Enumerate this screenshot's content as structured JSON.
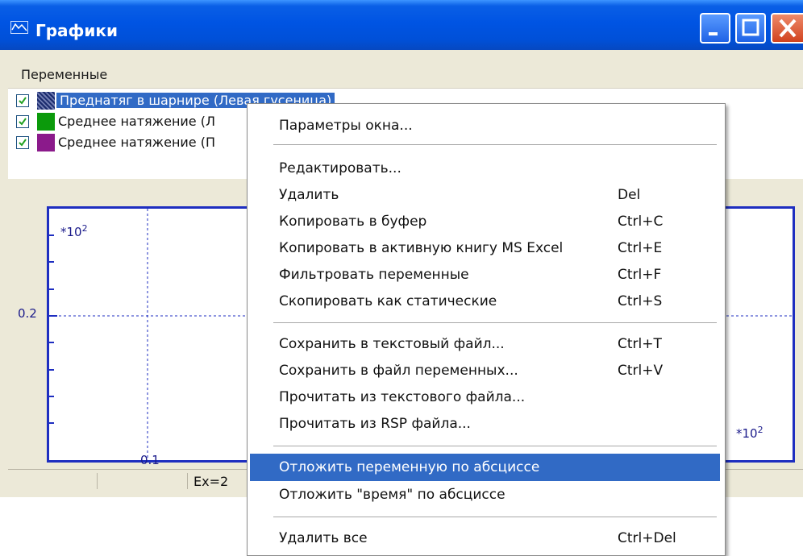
{
  "window": {
    "title": "Графики"
  },
  "variables": {
    "header": "Переменные",
    "items": [
      {
        "label": "Преднатяг в шарнире (Левая гусеница)",
        "color": "#1a2a6c",
        "checked": true,
        "selected": true
      },
      {
        "label": "Среднее натяжение (Л",
        "color": "#0b9a0b",
        "checked": true,
        "selected": false
      },
      {
        "label": "Среднее натяжение (П",
        "color": "#8b1a8b",
        "checked": true,
        "selected": false
      }
    ]
  },
  "plot": {
    "y_multiplier": "*10",
    "y_multiplier_exp": "2",
    "x_multiplier": "*10",
    "x_multiplier_exp": "2",
    "y_tick": "0.2",
    "x_tick": "0.1"
  },
  "status": {
    "ex": "Ex=2"
  },
  "menu": {
    "items": [
      {
        "label": "Параметры окна...",
        "shortcut": ""
      },
      {
        "label": "Редактировать...",
        "shortcut": ""
      },
      {
        "label": "Удалить",
        "shortcut": "Del"
      },
      {
        "label": "Копировать в буфер",
        "shortcut": "Ctrl+C"
      },
      {
        "label": "Копировать в активную книгу MS Excel",
        "shortcut": "Ctrl+E"
      },
      {
        "label": "Фильтровать переменные",
        "shortcut": "Ctrl+F"
      },
      {
        "label": "Скопировать как статические",
        "shortcut": "Ctrl+S"
      },
      {
        "label": "Сохранить в текстовый файл...",
        "shortcut": "Ctrl+T"
      },
      {
        "label": "Сохранить в файл переменных...",
        "shortcut": "Ctrl+V"
      },
      {
        "label": "Прочитать из текстового  файла...",
        "shortcut": ""
      },
      {
        "label": "Прочитать из RSP файла...",
        "shortcut": ""
      },
      {
        "label": "Отложить переменную по абсциссе",
        "shortcut": "",
        "highlighted": true
      },
      {
        "label": "Отложить \"время\" по абсциссе",
        "shortcut": ""
      },
      {
        "label": "Удалить все",
        "shortcut": "Ctrl+Del"
      }
    ]
  },
  "colors": {
    "titlebar": "#0054e3",
    "menu_highlight": "#316ac5",
    "plot_frame": "#1e2ec0"
  }
}
